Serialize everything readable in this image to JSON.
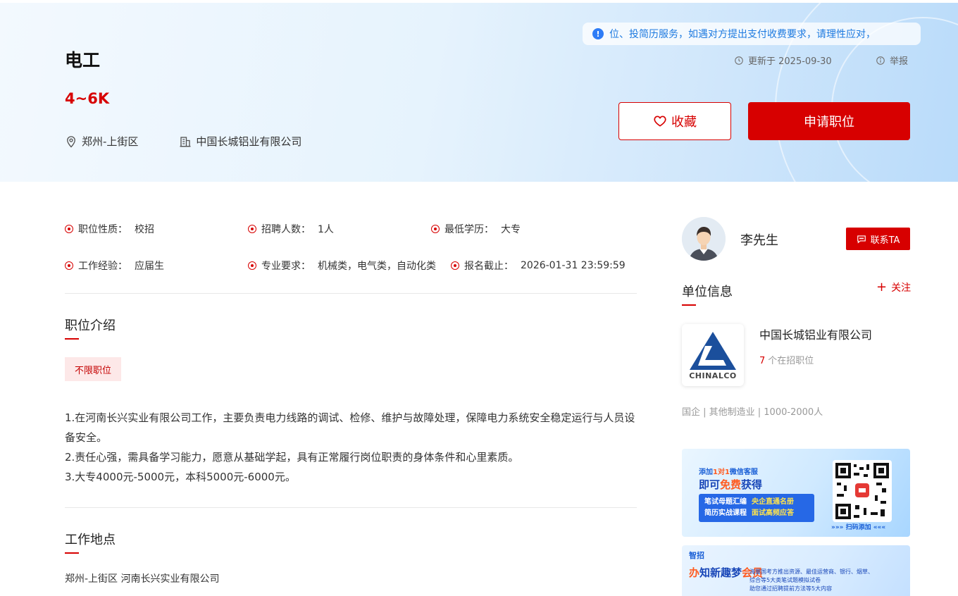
{
  "job": {
    "title": "电工",
    "salary": "4~6K",
    "location": "郑州-上街区",
    "company": "中国长城铝业有限公司"
  },
  "header": {
    "notice": "位、投简历服务，如遇对方提出支付收费要求，请理性应对，",
    "updated": "更新于 2025-09-30",
    "report": "举报",
    "favorite_label": "收藏",
    "apply_label": "申请职位"
  },
  "attributes": [
    {
      "label": "职位性质：",
      "value": "校招"
    },
    {
      "label": "招聘人数：",
      "value": "1人"
    },
    {
      "label": "最低学历：",
      "value": "大专"
    },
    {
      "label": "工作经验：",
      "value": "应届生"
    },
    {
      "label": "专业要求：",
      "value": "机械类，电气类，自动化类"
    },
    {
      "label": "报名截止：",
      "value": "2026-01-31 23:59:59"
    }
  ],
  "intro": {
    "title": "职位介绍",
    "tag": "不限职位",
    "lines": [
      "1.在河南长兴实业有限公司工作，主要负责电力线路的调试、检修、维护与故障处理，保障电力系统安全稳定运行与人员设备安全。",
      "2.责任心强，需具备学习能力，愿意从基础学起，具有正常履行岗位职责的身体条件和心里素质。",
      "3.大专4000元-5000元，本科5000元-6000元。"
    ]
  },
  "workplace": {
    "title": "工作地点",
    "address": "郑州-上街区 河南长兴实业有限公司"
  },
  "recruiter": {
    "name": "李先生",
    "contact_label": "联系TA"
  },
  "unit": {
    "title": "单位信息",
    "follow_label": "关注",
    "company_name": "中国长城铝业有限公司",
    "logo_text": "CHINALCO",
    "open_jobs_count": "7",
    "open_jobs_label": "个在招职位",
    "meta": "国企 | 其他制造业 | 1000-2000人"
  },
  "ads": {
    "ad1": {
      "line1_pre": "添加",
      "line1_hl": "1对1",
      "line1_post": "微信客服",
      "line2_pre": "即可",
      "line2_hl": "免费",
      "line2_post": "获得",
      "item1": "笔试母题汇编",
      "item2": "央企直通名册",
      "item3": "简历实战课程",
      "item4": "面试高频应答",
      "scan": "»»» 扫码添加 «««"
    },
    "ad2": {
      "brand": "智招",
      "head_pre": "办",
      "head_mid": "知新趣梦",
      "head_hl": "会员",
      "sub1": "海量国考方推出资源、最佳运营商、银行、烟草、",
      "sub2": "综合等5大类笔试题模拟试卷",
      "sub3": "助您通过招聘提前方法等5大内容"
    }
  },
  "colors": {
    "brand_red": "#d70000",
    "notice_blue": "#1d7ae0"
  }
}
